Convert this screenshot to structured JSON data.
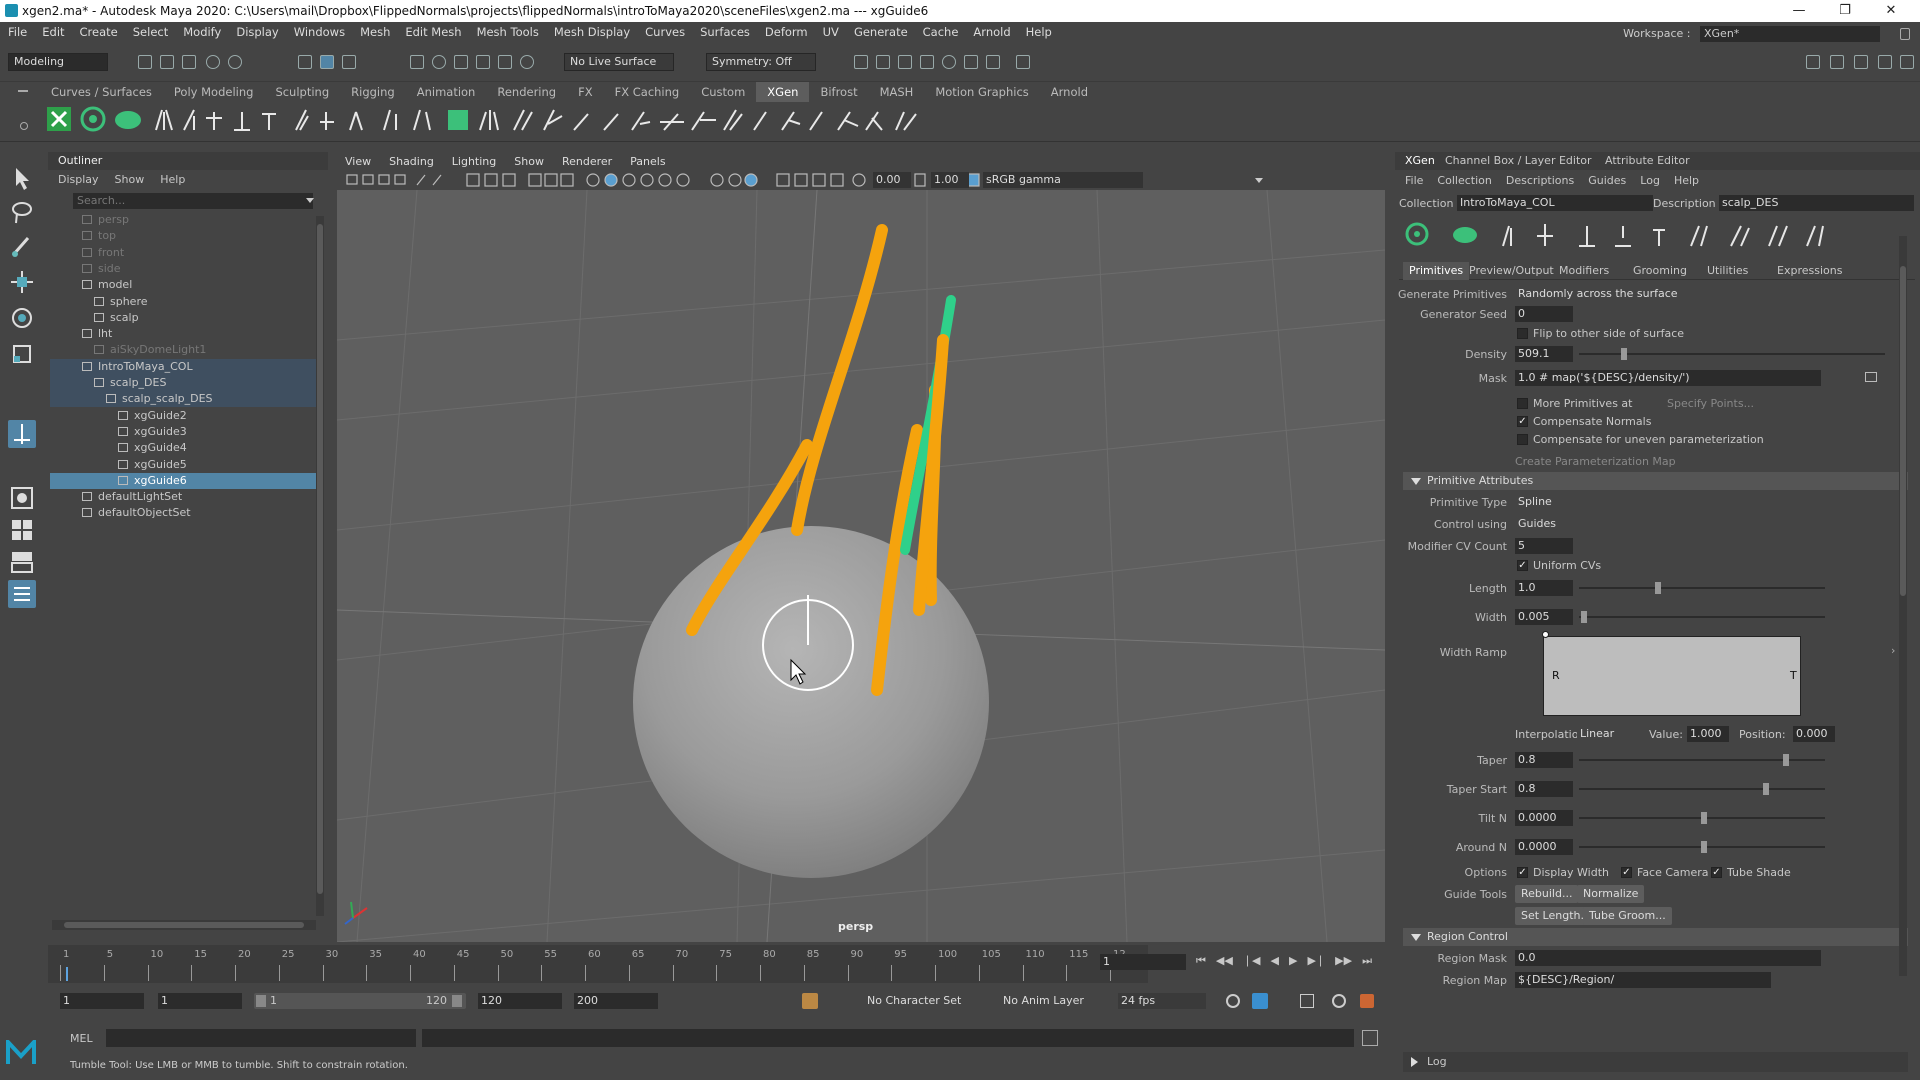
{
  "window": {
    "title": "xgen2.ma* - Autodesk Maya 2020: C:\\Users\\mail\\Dropbox\\FlippedNormals\\projects\\flippedNormals\\introToMaya2020\\sceneFiles\\xgen2.ma  ---  xgGuide6"
  },
  "menubar": [
    "File",
    "Edit",
    "Create",
    "Select",
    "Modify",
    "Display",
    "Windows",
    "Mesh",
    "Edit Mesh",
    "Mesh Tools",
    "Mesh Display",
    "Curves",
    "Surfaces",
    "Deform",
    "UV",
    "Generate",
    "Cache",
    "Arnold",
    "Help"
  ],
  "workspace": {
    "label": "Workspace :",
    "value": "XGen*"
  },
  "statusline": {
    "mode": "Modeling",
    "live_surface": "No Live Surface",
    "symmetry": "Symmetry: Off"
  },
  "shelf_tabs": [
    "Curves / Surfaces",
    "Poly Modeling",
    "Sculpting",
    "Rigging",
    "Animation",
    "Rendering",
    "FX",
    "FX Caching",
    "Custom",
    "XGen",
    "Bifrost",
    "MASH",
    "Motion Graphics",
    "Arnold"
  ],
  "shelf_active": "XGen",
  "outliner": {
    "tab": "Outliner",
    "menu": [
      "Display",
      "Show",
      "Help"
    ],
    "search_placeholder": "Search...",
    "items": [
      {
        "label": "persp",
        "depth": 1,
        "dim": true
      },
      {
        "label": "top",
        "depth": 1,
        "dim": true
      },
      {
        "label": "front",
        "depth": 1,
        "dim": true
      },
      {
        "label": "side",
        "depth": 1,
        "dim": true
      },
      {
        "label": "model",
        "depth": 1
      },
      {
        "label": "sphere",
        "depth": 2
      },
      {
        "label": "scalp",
        "depth": 2
      },
      {
        "label": "lht",
        "depth": 1
      },
      {
        "label": "aiSkyDomeLight1",
        "depth": 2,
        "dim": true
      },
      {
        "label": "IntroToMaya_COL",
        "depth": 1,
        "hl": true
      },
      {
        "label": "scalp_DES",
        "depth": 2,
        "hl": true
      },
      {
        "label": "scalp_scalp_DES",
        "depth": 3,
        "hl": true
      },
      {
        "label": "xgGuide2",
        "depth": 4
      },
      {
        "label": "xgGuide3",
        "depth": 4
      },
      {
        "label": "xgGuide4",
        "depth": 4
      },
      {
        "label": "xgGuide5",
        "depth": 4
      },
      {
        "label": "xgGuide6",
        "depth": 4,
        "sel": true
      },
      {
        "label": "defaultLightSet",
        "depth": 1
      },
      {
        "label": "defaultObjectSet",
        "depth": 1
      }
    ]
  },
  "viewport": {
    "menu": [
      "View",
      "Shading",
      "Lighting",
      "Show",
      "Renderer",
      "Panels"
    ],
    "field1": "0.00",
    "field2": "1.00",
    "colorspace": "sRGB gamma",
    "camera": "persp"
  },
  "timeline": {
    "ticks": [
      "1",
      "5",
      "10",
      "15",
      "20",
      "25",
      "30",
      "35",
      "40",
      "45",
      "50",
      "55",
      "60",
      "65",
      "70",
      "75",
      "80",
      "85",
      "90",
      "95",
      "100",
      "105",
      "110",
      "115",
      "12"
    ],
    "current": "1"
  },
  "range": {
    "start": "1",
    "start2": "1",
    "slider_start": "1",
    "slider_end": "120",
    "end": "120",
    "end2": "200",
    "character": "No Character Set",
    "anim_layer": "No Anim Layer",
    "fps": "24 fps"
  },
  "cmdline": {
    "lang": "MEL",
    "help": "Tumble Tool: Use LMB or MMB to tumble. Shift to constrain rotation."
  },
  "xgen": {
    "tabs": [
      "XGen",
      "Channel Box / Layer Editor",
      "Attribute Editor"
    ],
    "menu": [
      "File",
      "Collection",
      "Descriptions",
      "Guides",
      "Log",
      "Help"
    ],
    "collection_label": "Collection",
    "collection": "IntroToMaya_COL",
    "description_label": "Description",
    "description": "scalp_DES",
    "subtabs": [
      "Primitives",
      "Preview/Output",
      "Modifiers",
      "Grooming",
      "Utilities",
      "Expressions"
    ],
    "gen_primitives_label": "Generate Primitives",
    "gen_primitives": "Randomly across the surface",
    "seed_label": "Generator Seed",
    "seed": "0",
    "flip_label": "Flip to other side of surface",
    "density_label": "Density",
    "density": "509.1",
    "mask_label": "Mask",
    "mask": "1.0 # map('${DESC}/density/')",
    "more_prims": "More Primitives at",
    "specify_points": "Specify Points...",
    "comp_normals": "Compensate Normals",
    "comp_uneven": "Compensate for uneven parameterization",
    "create_param": "Create Parameterization Map",
    "prim_attr_title": "Primitive Attributes",
    "prim_type_label": "Primitive Type",
    "prim_type": "Spline",
    "control_label": "Control using",
    "control": "Guides",
    "cv_count_label": "Modifier CV Count",
    "cv_count": "5",
    "uniform_cvs": "Uniform CVs",
    "length_label": "Length",
    "length": "1.0",
    "width_label": "Width",
    "width": "0.005",
    "width_ramp_label": "Width Ramp",
    "ramp_r": "R",
    "ramp_t": "T",
    "interp_label": "Interpolation:",
    "interp": "Linear",
    "value_label": "Value:",
    "value": "1.000",
    "position_label": "Position:",
    "position": "0.000",
    "taper_label": "Taper",
    "taper": "0.8",
    "taper_start_label": "Taper Start",
    "taper_start": "0.8",
    "tilt_label": "Tilt N",
    "tilt": "0.0000",
    "around_label": "Around N",
    "around": "0.0000",
    "options_label": "Options",
    "display_width": "Display Width",
    "face_camera": "Face Camera",
    "tube_shade": "Tube Shade",
    "guide_tools_label": "Guide Tools",
    "rebuild": "Rebuild...",
    "normalize": "Normalize",
    "set_length": "Set Length...",
    "tube_groom": "Tube Groom...",
    "region_title": "Region Control",
    "region_mask_label": "Region Mask",
    "region_mask": "0.0",
    "region_map_label": "Region Map",
    "region_map": "${DESC}/Region/",
    "log": "Log"
  },
  "colors": {
    "guide": "#f5a30d",
    "selected_guide": "#2fd08a",
    "selection": "#5285a6"
  }
}
